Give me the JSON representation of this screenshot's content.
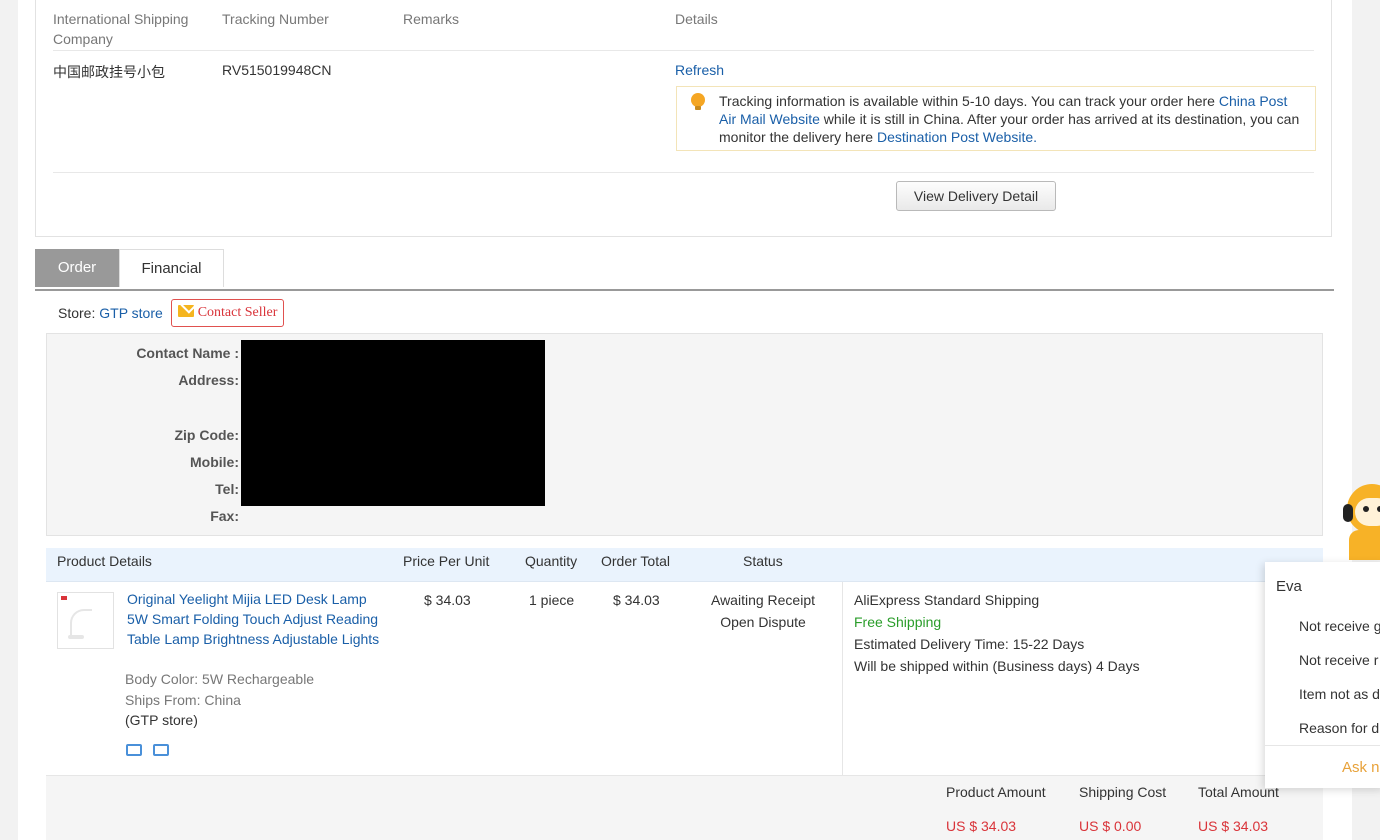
{
  "shipping": {
    "headers": [
      "International Shipping Company",
      "Tracking Number",
      "Remarks",
      "Details"
    ],
    "carrier": "中国邮政挂号小包",
    "tracking_number": "RV515019948CN",
    "remarks": "",
    "refresh_label": "Refresh",
    "tip_text_1": "Tracking information is available within 5-10 days. You can track your order here ",
    "tip_link_1": "China Post Air Mail Website",
    "tip_text_2": " while it is still in China. After your order has arrived at its destination, you can monitor the delivery here ",
    "tip_link_2": "Destination Post Website",
    "tip_text_3": ".",
    "view_delivery_label": "View Delivery Detail"
  },
  "tabs": [
    {
      "label": "Order",
      "active": true
    },
    {
      "label": "Financial",
      "active": false
    }
  ],
  "store": {
    "label": "Store: ",
    "name": "GTP store",
    "contact_label": "Contact Seller"
  },
  "address": {
    "contact_name_label": "Contact Name :",
    "address_label": "Address:",
    "zip_label": "Zip Code:",
    "mobile_label": "Mobile:",
    "tel_label": "Tel:",
    "fax_label": "Fax:"
  },
  "products": {
    "headers": {
      "details": "Product Details",
      "price": "Price Per Unit",
      "quantity": "Quantity",
      "total": "Order Total",
      "status": "Status"
    },
    "item": {
      "name": "Original Yeelight Mijia LED Desk Lamp 5W Smart Folding Touch Adjust Reading Table Lamp Brightness Adjustable Lights",
      "body_color": "Body Color: 5W Rechargeable",
      "ships_from": "Ships From: China",
      "store": "(GTP store)",
      "price": "$ 34.03",
      "quantity": "1 piece",
      "total": "$ 34.03",
      "status": "Awaiting Receipt",
      "dispute_label": "Open Dispute",
      "shipping_method": "AliExpress Standard Shipping",
      "shipping_fee": "Free Shipping",
      "delivery_label": "Estimated Delivery Time:",
      "delivery_value": "15-22 Days",
      "ship_within_label": "Will be shipped within (Business days)",
      "ship_within_value": "4 Days"
    }
  },
  "totals": {
    "product_amount_label": "Product Amount",
    "shipping_cost_label": "Shipping Cost",
    "total_amount_label": "Total Amount",
    "product_amount": "US $ 34.03",
    "shipping_cost": "US $ 0.00",
    "total_amount": "US $ 34.03"
  },
  "chat": {
    "title": "Eva",
    "items": [
      "Not receive g",
      "Not receive r",
      "Item not as d",
      "Reason for d"
    ],
    "ask_label": "Ask n"
  },
  "colors": {
    "link": "#1a5fa8",
    "price_red": "#d9343a",
    "free_green": "#2a9d2a",
    "tab_active": "#999999"
  }
}
